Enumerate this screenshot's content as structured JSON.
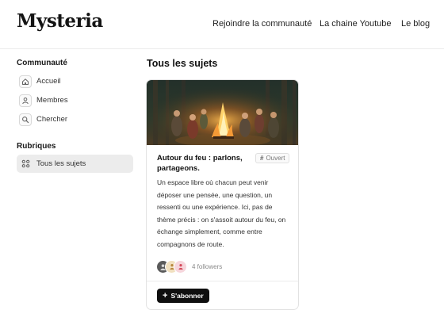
{
  "brand": {
    "logo_text": "Mysteria"
  },
  "topnav": {
    "items": [
      {
        "label": "Rejoindre la communauté"
      },
      {
        "label": "La chaine Youtube"
      },
      {
        "label": "Le blog"
      }
    ]
  },
  "sidebar": {
    "community_heading": "Communauté",
    "community_items": [
      {
        "label": "Accueil",
        "icon": "home-icon"
      },
      {
        "label": "Membres",
        "icon": "user-icon"
      },
      {
        "label": "Chercher",
        "icon": "search-icon"
      }
    ],
    "rubriques_heading": "Rubriques",
    "rubriques_items": [
      {
        "label": "Tous les sujets",
        "icon": "grid-icon",
        "active": true
      }
    ]
  },
  "main": {
    "title": "Tous les sujets",
    "card": {
      "title": "Autour du feu : parlons, partageons.",
      "badge": {
        "symbol": "#",
        "label": "Ouvert"
      },
      "description": "Un espace libre où chacun peut venir déposer une pensée, une question, un ressenti ou une expérience. Ici, pas de thème précis : on s'assoit autour du feu, on échange simplement, comme entre compagnons de route.",
      "followers_text": "4 followers",
      "subscribe_label": "S'abonner",
      "subscribe_symbol": "+"
    }
  },
  "colors": {
    "accent": "#0f0f0f",
    "active_bg": "#ececec",
    "border": "#e2e2e2"
  }
}
